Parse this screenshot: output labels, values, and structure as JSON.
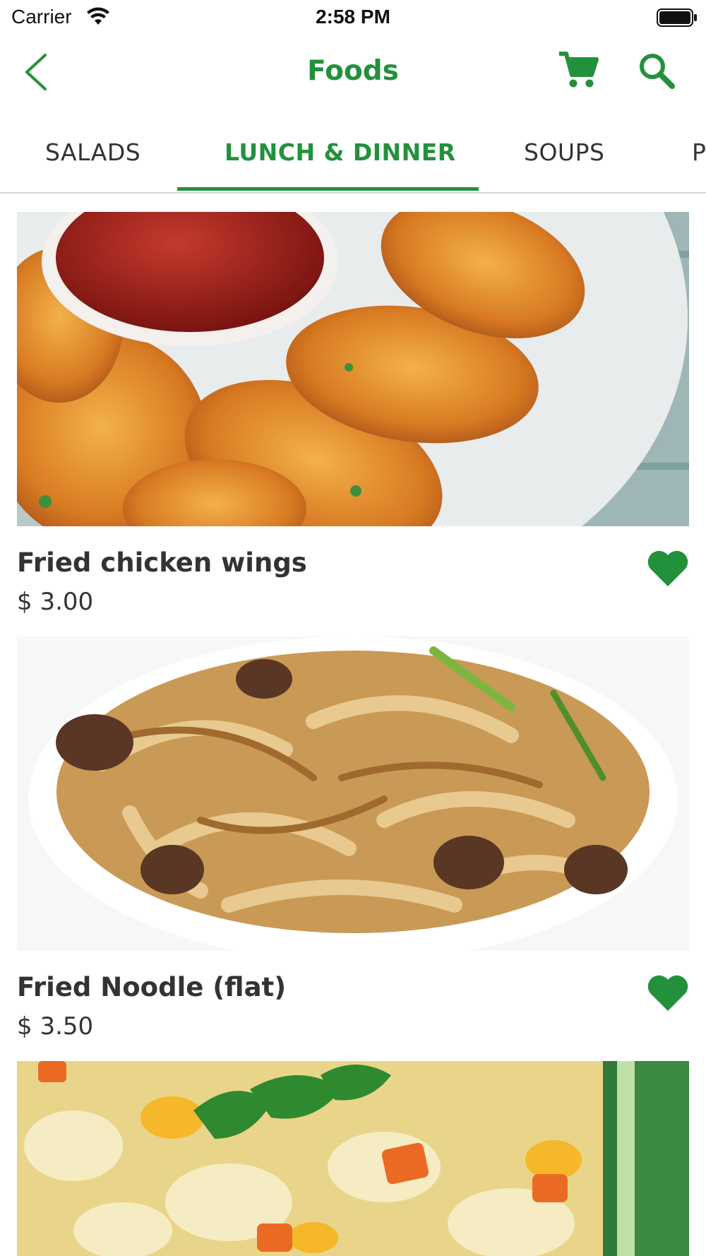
{
  "status_bar": {
    "carrier": "Carrier",
    "time": "2:58 PM"
  },
  "nav": {
    "title": "Foods",
    "back_icon": "chevron-left-icon",
    "cart_icon": "cart-icon",
    "search_icon": "search-icon"
  },
  "tabs": [
    {
      "label": "SALADS",
      "active": false
    },
    {
      "label": "LUNCH & DINNER",
      "active": true
    },
    {
      "label": "SOUPS",
      "active": false
    },
    {
      "label": "P",
      "active": false
    }
  ],
  "items": [
    {
      "name": "Fried chicken wings",
      "price": "$ 3.00",
      "favorite": true,
      "image": "fried-chicken-wings-photo"
    },
    {
      "name": "Fried Noodle (flat)",
      "price": "$ 3.50",
      "favorite": true,
      "image": "fried-noodle-photo"
    },
    {
      "name": "",
      "price": "",
      "favorite": false,
      "image": "fried-rice-photo"
    }
  ],
  "colors": {
    "accent": "#23913c",
    "text": "#333333",
    "divider": "#d6d6d6"
  }
}
